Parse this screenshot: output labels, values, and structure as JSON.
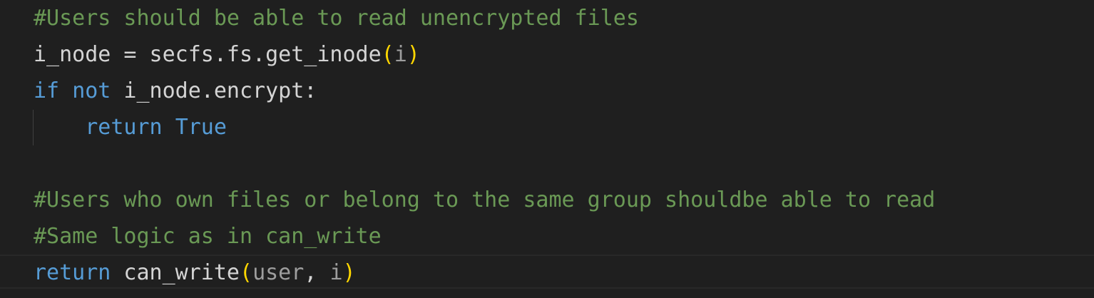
{
  "editor": {
    "lines": [
      {
        "tokens": [
          {
            "text": "#Users should be able to read unencrypted files",
            "kind": "comment"
          }
        ]
      },
      {
        "tokens": [
          {
            "text": "i_node = secfs.fs.get_inode",
            "kind": "ident"
          },
          {
            "text": "(",
            "kind": "bracket"
          },
          {
            "text": "i",
            "kind": "param"
          },
          {
            "text": ")",
            "kind": "bracket"
          }
        ]
      },
      {
        "tokens": [
          {
            "text": "if",
            "kind": "keyword"
          },
          {
            "text": " ",
            "kind": "ident"
          },
          {
            "text": "not",
            "kind": "keyword"
          },
          {
            "text": " i_node.encrypt:",
            "kind": "ident"
          }
        ]
      },
      {
        "tokens": [
          {
            "text": "    ",
            "kind": "ident"
          },
          {
            "text": "return",
            "kind": "keyword"
          },
          {
            "text": " ",
            "kind": "ident"
          },
          {
            "text": "True",
            "kind": "builtin"
          }
        ]
      },
      {
        "tokens": []
      },
      {
        "tokens": [
          {
            "text": "#Users who own files or belong to the same group shouldbe able to read",
            "kind": "comment"
          }
        ]
      },
      {
        "tokens": [
          {
            "text": "#Same logic as in can_write",
            "kind": "comment"
          }
        ]
      },
      {
        "tokens": [
          {
            "text": "return",
            "kind": "keyword"
          },
          {
            "text": " can_write",
            "kind": "ident"
          },
          {
            "text": "(",
            "kind": "bracket"
          },
          {
            "text": "user",
            "kind": "param"
          },
          {
            "text": ", ",
            "kind": "punct"
          },
          {
            "text": "i",
            "kind": "param"
          },
          {
            "text": ")",
            "kind": "bracket"
          }
        ]
      }
    ]
  },
  "colors": {
    "background": "#1f1f1f",
    "comment": "#6a9955",
    "keyword": "#569cd6",
    "identifier": "#d4d4d4",
    "parameter": "#9e9e9e",
    "bracket": "#ffd700"
  }
}
